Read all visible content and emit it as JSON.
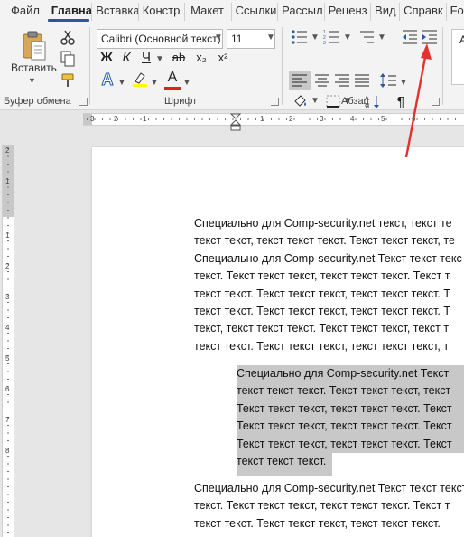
{
  "tabs": [
    "Файл",
    "Главна",
    "Вставка",
    "Констр",
    "Макет",
    "Ссылки",
    "Рассыл",
    "Реценз",
    "Вид",
    "Справк",
    "Fo"
  ],
  "active_tab": "Главна",
  "clipboard": {
    "paste_label": "Вставить",
    "group_label": "Буфер обмена"
  },
  "font": {
    "name": "Calibri (Основной текст)",
    "size": "11",
    "group_label": "Шрифт",
    "bold": "Ж",
    "italic": "К",
    "underline": "Ч",
    "strike": "ab",
    "subscript": "x₂",
    "superscript": "x²",
    "text_effects": "A",
    "font_color": "A",
    "highlight_color": "#ffff00",
    "font_color_value": "#e0201c"
  },
  "paragraph": {
    "group_label": "Абзац",
    "pilcrow": "¶"
  },
  "styles": {
    "preview": "А"
  },
  "ruler": {
    "h_numbers": [
      "3",
      "2",
      "1",
      "1",
      "2",
      "3",
      "4",
      "5",
      "6"
    ],
    "v_numbers": [
      "2",
      "1",
      "1",
      "2",
      "3",
      "4",
      "5",
      "6",
      "7",
      "8"
    ]
  },
  "document": {
    "para1": [
      "Специально для Comp-security.net текст, текст те",
      "текст текст, текст текст текст. Текст текст текст, те",
      "Специально для Comp-security.net Текст текст текс",
      "текст. Текст текст текст, текст текст текст. Текст т",
      "текст текст. Текст текст текст, текст текст текст. Т",
      "текст текст. Текст текст текст, текст текст текст. Т",
      "текст, текст текст текст. Текст текст текст, текст т",
      "текст текст. Текст текст текст, текст текст текст, т"
    ],
    "para2": [
      "Специально для Comp-security.net Текст",
      "текст текст текст. Текст текст текст, текст",
      "Текст текст текст, текст текст текст. Текст",
      "Текст текст текст, текст текст текст. Текст",
      "Текст текст текст, текст текст текст. Текст",
      "текст текст текст."
    ],
    "para3": [
      "Специально для Comp-security.net Текст текст текст",
      "текст. Текст текст текст, текст текст текст. Текст т",
      "текст текст. Текст текст текст, текст текст текст."
    ]
  }
}
